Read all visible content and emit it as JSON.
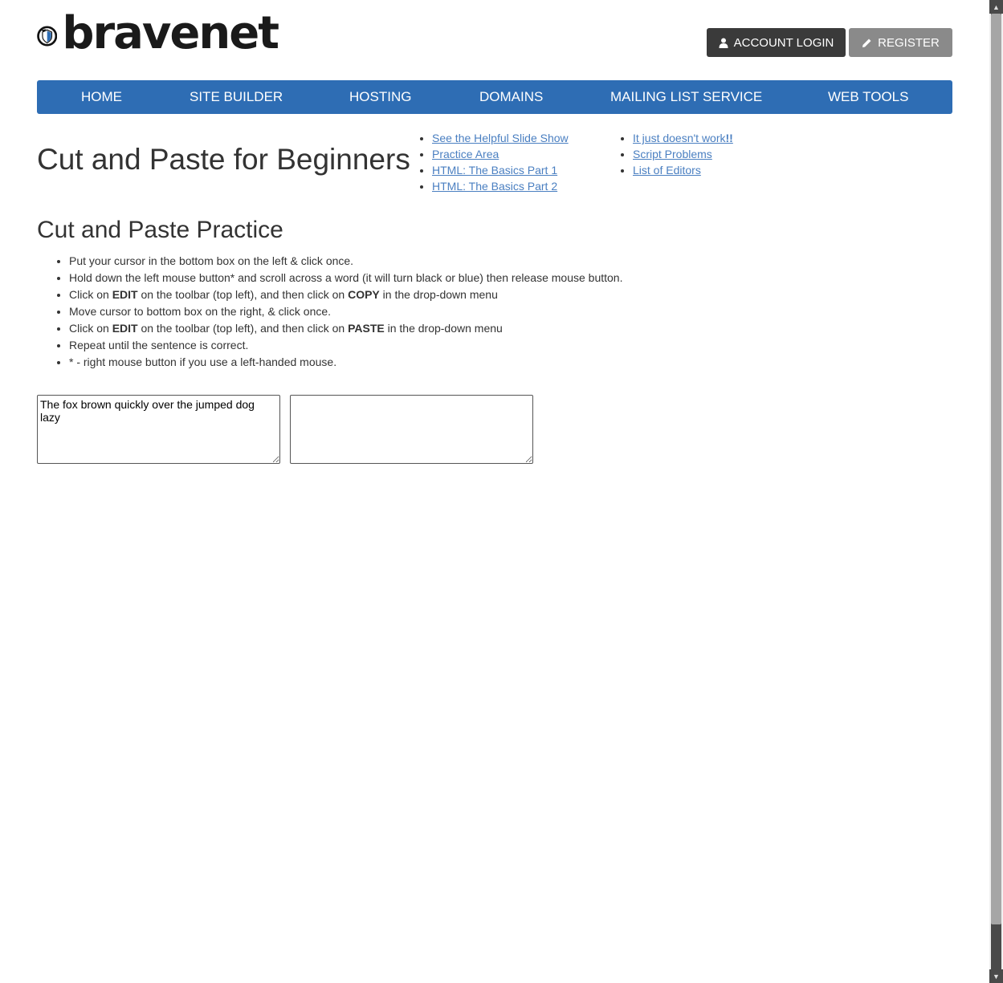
{
  "header": {
    "logo_text": "bravenet",
    "login_label": "ACCOUNT LOGIN",
    "register_label": "REGISTER"
  },
  "nav": {
    "items": [
      {
        "label": "HOME"
      },
      {
        "label": "SITE BUILDER"
      },
      {
        "label": "HOSTING"
      },
      {
        "label": "DOMAINS"
      },
      {
        "label": "MAILING LIST SERVICE"
      },
      {
        "label": "WEB TOOLS"
      }
    ]
  },
  "main": {
    "title": "Cut and Paste for Beginners",
    "links_a": [
      "See the Helpful Slide Show",
      "Practice Area",
      "HTML: The Basics Part 1",
      "HTML: The Basics Part 2"
    ],
    "links_b": [
      {
        "text": "It just doesn't work",
        "suffix": "!!"
      },
      {
        "text": "Script Problems"
      },
      {
        "text": "List of Editors"
      }
    ],
    "section_title": "Cut and Paste Practice",
    "steps": [
      {
        "pre": "Put your cursor in the bottom box on the left & click once."
      },
      {
        "pre": "Hold down the left mouse button* and scroll across a word (it will turn black or blue) then release mouse button."
      },
      {
        "pre": "Click on ",
        "b1": "EDIT",
        "mid": " on the toolbar (top left), and then click on ",
        "b2": "COPY",
        "post": " in the drop-down menu"
      },
      {
        "pre": "Move cursor to bottom box on the right, & click once."
      },
      {
        "pre": "Click on ",
        "b1": "EDIT",
        "mid": " on the toolbar (top left), and then click on ",
        "b2": "PASTE",
        "post": " in the drop-down menu"
      },
      {
        "pre": "Repeat until the sentence is correct."
      },
      {
        "pre": "* - right mouse button if you use a left-handed mouse."
      }
    ],
    "textarea_left_value": "The fox brown quickly over the jumped dog lazy",
    "textarea_right_value": ""
  },
  "colors": {
    "nav_bg": "#2e6db4",
    "link": "#4a7fc1",
    "login_bg": "#3a3a3a",
    "register_bg": "#8a8a8a"
  }
}
